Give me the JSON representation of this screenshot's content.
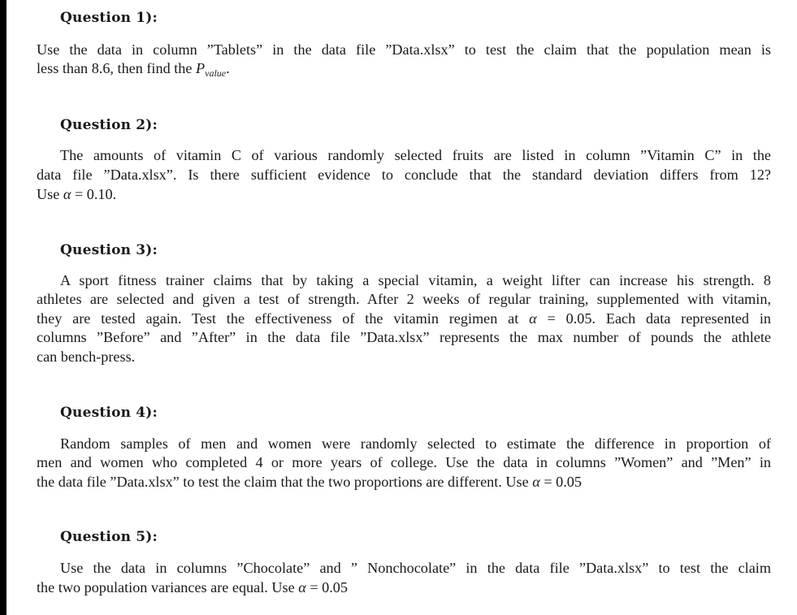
{
  "document": {
    "questions": [
      {
        "title": "Question 1):",
        "lines": [
          "Use the data in column ”Tablets” in the data file ”Data.xlsx” to test the claim that the population mean is",
          "less than 8.6, then find the "
        ],
        "math_symbol": "P",
        "math_subscript": "value",
        "trailing": "."
      },
      {
        "title": "Question 2):",
        "lines": [
          "The amounts of vitamin C of various randomly selected fruits are listed in column ”Vitamin C” in the",
          "data file ”Data.xlsx”.  Is there sufficient evidence to conclude that the standard deviation differs from 12?",
          "Use α = 0.10."
        ]
      },
      {
        "title": "Question 3):",
        "lines": [
          "A sport fitness trainer claims that by taking a special vitamin, a weight lifter can increase his strength. 8",
          "athletes are selected and given a test of strength. After 2 weeks of regular training, supplemented with vitamin,",
          "they are tested again. Test the effectiveness of the vitamin regimen at α = 0.05. Each data represented in",
          "columns ”Before” and ”After” in the data file ”Data.xlsx” represents the max number of pounds the athlete",
          "can bench-press."
        ]
      },
      {
        "title": "Question 4):",
        "lines": [
          "Random samples of men and women were randomly selected to estimate the difference in proportion of",
          "men and women who completed 4 or more years of college. Use the data in columns ”Women” and ”Men” in",
          "the data file ”Data.xlsx” to test the claim that the two proportions are different. Use α = 0.05"
        ]
      },
      {
        "title": "Question 5):",
        "lines": [
          "Use the data in columns ”Chocolate” and ” Nonchocolate” in the data file ”Data.xlsx” to test the claim",
          "the two population variances are equal. Use α = 0.05"
        ]
      }
    ]
  }
}
